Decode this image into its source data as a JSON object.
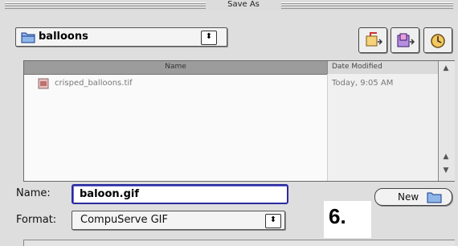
{
  "window": {
    "title": "Save As"
  },
  "folder_popup": {
    "label": "balloons",
    "icon": "folder-icon",
    "stepper": "⬍"
  },
  "toolbar": {
    "buttons": [
      {
        "name": "desktop-button",
        "icon": "desktop-icon"
      },
      {
        "name": "new-folder-button",
        "icon": "new-folder-icon"
      },
      {
        "name": "recent-button",
        "icon": "clock-icon"
      }
    ]
  },
  "file_list": {
    "columns": [
      "Name",
      "Date Modified"
    ],
    "rows": [
      {
        "name": "crisped_balloons.tif",
        "date": "Today, 9:05 AM",
        "icon": "tif-file-icon"
      }
    ],
    "scroll_up": "▲",
    "scroll_down": "▼"
  },
  "name_label": "Name:",
  "name_value": "baloon.gif",
  "format_label": "Format:",
  "format_value": "CompuServe GIF",
  "format_stepper": "⬍",
  "new_button": {
    "label": "New",
    "icon": "folder-icon"
  },
  "step_number": "6.",
  "colors": {
    "focus_ring": "#2a2aa0",
    "header": "#9c9c9c"
  }
}
